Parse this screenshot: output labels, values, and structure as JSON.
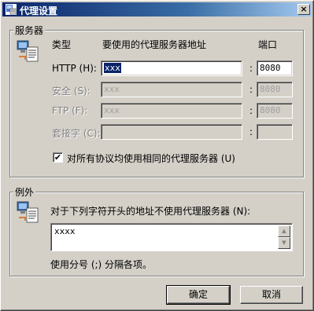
{
  "window": {
    "title": "代理设置",
    "close_glyph": "×"
  },
  "servers": {
    "group_title": "服务器",
    "col_type": "类型",
    "col_address": "要使用的代理服务器地址",
    "col_port": "端口",
    "rows": [
      {
        "label": "HTTP (H):",
        "address": "xxx",
        "port": "8080",
        "enabled": true
      },
      {
        "label": "安全 (S):",
        "address": "xxx",
        "port": "8080",
        "enabled": false
      },
      {
        "label": "FTP (F):",
        "address": "xxx",
        "port": "8080",
        "enabled": false
      },
      {
        "label": "套接字 (C):",
        "address": "",
        "port": "",
        "enabled": false
      }
    ],
    "colon": ":",
    "same_proxy_label": "对所有协议均使用相同的代理服务器 (U)",
    "same_proxy_checked": true,
    "check_glyph": "✔"
  },
  "exceptions": {
    "group_title": "例外",
    "description": "对于下列字符开头的地址不使用代理服务器 (N):",
    "value": "xxxx",
    "hint": "使用分号 (;) 分隔各项。"
  },
  "buttons": {
    "ok": "确定",
    "cancel": "取消"
  },
  "colors": {
    "face": "#d4d0c8",
    "titlebar_start": "#0a246a",
    "titlebar_end": "#a6caf0"
  }
}
